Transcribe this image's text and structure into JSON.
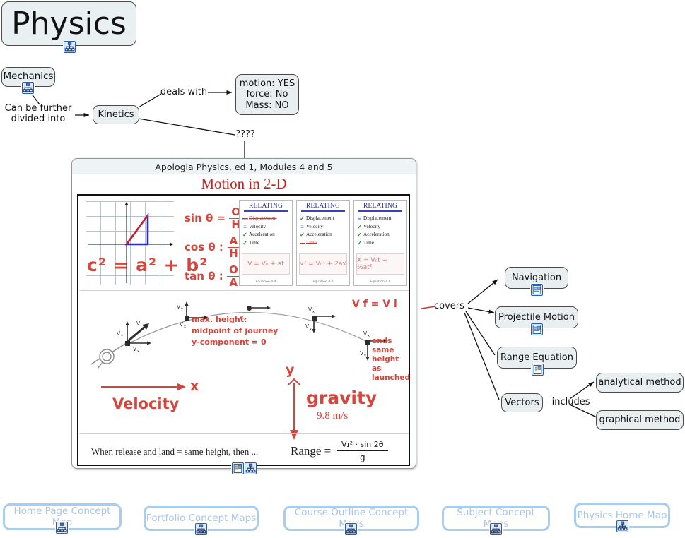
{
  "map": {
    "title_node": {
      "label": "Physics"
    },
    "nodes": [
      {
        "id": "mechanics",
        "label": "Mechanics"
      },
      {
        "id": "kinetics",
        "label": "Kinetics"
      },
      {
        "id": "motion-facts",
        "label": "motion: YES\nforce: No\nMass: NO"
      },
      {
        "id": "navigation",
        "label": "Navigation"
      },
      {
        "id": "projectile-motion",
        "label": "Projectile Motion"
      },
      {
        "id": "range-equation",
        "label": "Range Equation"
      },
      {
        "id": "vectors",
        "label": "Vectors"
      },
      {
        "id": "analytical-method",
        "label": "analytical method"
      },
      {
        "id": "graphical-method",
        "label": "graphical method"
      }
    ],
    "edge_labels": [
      {
        "id": "divided-into",
        "text": "Can be further\ndivided into"
      },
      {
        "id": "deals-with",
        "text": "deals with"
      },
      {
        "id": "unknown",
        "text": "????"
      },
      {
        "id": "covers",
        "text": "covers"
      },
      {
        "id": "includes",
        "text": "– includes"
      }
    ],
    "icons": {
      "concept_map": "concept-map-icon",
      "resource": "resource-note-icon"
    },
    "colors": {
      "node_fill": "#e9eff1",
      "node_border": "#4a4a4a",
      "link_border": "#a9cdf0",
      "link_text": "#a9c6e8",
      "accent_red": "#c32222",
      "edge_red": "#c8352c"
    }
  },
  "panel": {
    "header": "Apologia Physics, ed 1, Modules 4 and 5",
    "title": "Motion in 2-D",
    "trig": {
      "sin": {
        "fn": "sin θ =",
        "num": "O",
        "den": "H"
      },
      "cos": {
        "fn": "cos θ :",
        "num": "A",
        "den": "H"
      },
      "tan": {
        "fn": "tan θ :",
        "num": "O",
        "den": "A"
      }
    },
    "pythagorean": "c² = a² + b²",
    "relating_cards": [
      {
        "title": "RELATING",
        "items": [
          {
            "mark": "strike",
            "label": "Displacement"
          },
          {
            "mark": "equals",
            "label": "Velocity"
          },
          {
            "mark": "check",
            "label": "Acceleration"
          },
          {
            "mark": "check",
            "label": "Time"
          }
        ],
        "equation": "V = V₀ + at",
        "footnote": "Equation 4.4"
      },
      {
        "title": "RELATING",
        "items": [
          {
            "mark": "check",
            "label": "Displacement"
          },
          {
            "mark": "equals",
            "label": "Velocity"
          },
          {
            "mark": "check",
            "label": "Acceleration"
          },
          {
            "mark": "strike",
            "label": "Time"
          }
        ],
        "equation": "v² = V₀² + 2ax",
        "footnote": "Equation 4.6"
      },
      {
        "title": "RELATING",
        "items": [
          {
            "mark": "equals",
            "label": "Displacement"
          },
          {
            "mark": "check",
            "label": "Velocity"
          },
          {
            "mark": "check",
            "label": "Acceleration"
          },
          {
            "mark": "check",
            "label": "Time"
          }
        ],
        "equation": "X = V₀t + ½at²",
        "footnote": "Equation 4.8"
      }
    ],
    "trajectory": {
      "note_max_height": "max. height:\nmidpoint of journey\ny-component = 0",
      "note_ends": "ends\nsame\nheight\nas\nlaunched",
      "vf_vi": "V f = V i",
      "axis_x": "x",
      "axis_y": "y",
      "velocity_label": "Velocity",
      "gravity_label": "gravity",
      "gravity_value": "9.8 m/s",
      "vector_x": "Vx",
      "vector_y": "Vy",
      "vector_v": "V"
    },
    "footer_note": "When release and land = same height, then ...",
    "range": {
      "label": "Range =",
      "numerator": "Vɪ² · sin 2θ",
      "denominator": "g"
    }
  },
  "footer_links": [
    {
      "id": "home-page-concept-map",
      "label": "Home Page Concept Map"
    },
    {
      "id": "portfolio-concept-maps",
      "label": "Portfolio Concept Maps"
    },
    {
      "id": "course-outline-concept-maps",
      "label": "Course Outline Concept Maps"
    },
    {
      "id": "subject-concept-maps",
      "label": "Subject Concept Maps"
    },
    {
      "id": "physics-home-map",
      "label": "Physics Home Map"
    }
  ]
}
